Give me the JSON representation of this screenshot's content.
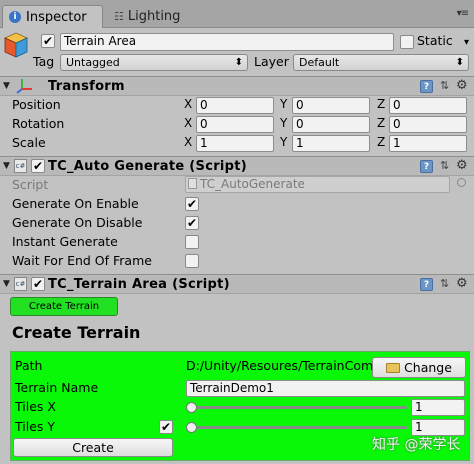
{
  "tabs": {
    "inspector": "Inspector",
    "lighting": "Lighting"
  },
  "object": {
    "active": true,
    "name": "Terrain Area",
    "static_label": "Static",
    "static": false,
    "tag_label": "Tag",
    "tag_value": "Untagged",
    "layer_label": "Layer",
    "layer_value": "Default"
  },
  "transform": {
    "title": "Transform",
    "position": {
      "label": "Position",
      "x": "0",
      "y": "0",
      "z": "0"
    },
    "rotation": {
      "label": "Rotation",
      "x": "0",
      "y": "0",
      "z": "0"
    },
    "scale": {
      "label": "Scale",
      "x": "1",
      "y": "1",
      "z": "1"
    },
    "axes": {
      "x": "X",
      "y": "Y",
      "z": "Z"
    }
  },
  "auto_generate": {
    "title": "TC_Auto Generate (Script)",
    "enabled": true,
    "script_label": "Script",
    "script_value": "TC_AutoGenerate",
    "rows": [
      {
        "label": "Generate On Enable",
        "checked": true
      },
      {
        "label": "Generate On Disable",
        "checked": true
      },
      {
        "label": "Instant Generate",
        "checked": false
      },
      {
        "label": "Wait For End Of Frame",
        "checked": false
      }
    ]
  },
  "terrain_area": {
    "title": "TC_Terrain Area (Script)",
    "enabled": true,
    "create_terrain_button": "Create Terrain",
    "section_title": "Create Terrain",
    "path_label": "Path",
    "path_value": "D:/Unity/Resoures/TerrainCom",
    "change_button": "Change",
    "terrain_name_label": "Terrain Name",
    "terrain_name_value": "TerrainDemo1",
    "tiles_x_label": "Tiles X",
    "tiles_x_value": "1",
    "tiles_y_label": "Tiles Y",
    "tiles_y_value": "1",
    "tiles_y_checked": true,
    "create_button": "Create"
  },
  "watermark": "知乎 @荣学长",
  "colors": {
    "green_button": "#22e022",
    "green_area": "#08f808",
    "panel_bg": "#c2c2c2"
  }
}
